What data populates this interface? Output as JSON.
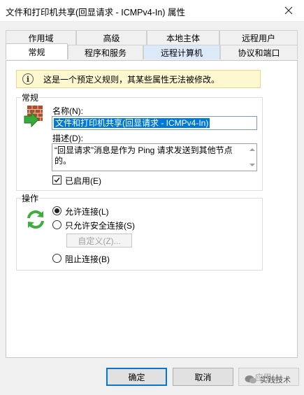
{
  "window": {
    "title": "文件和打印机共享(回显请求 - ICMPv4-In) 属性"
  },
  "tabs": {
    "row1": [
      "作用域",
      "高级",
      "本地主体",
      "远程用户"
    ],
    "row2": [
      "常规",
      "程序和服务",
      "远程计算机",
      "协议和端口"
    ],
    "active": "常规"
  },
  "info_bar": {
    "text": "这是一个预定义规则，其某些属性无法被修改。"
  },
  "general": {
    "group_label": "常规",
    "name_label": "名称(N):",
    "name_value": "文件和打印机共享(回显请求 - ICMPv4-In)",
    "description_label": "描述(D):",
    "description_value": "“回显请求”消息是作为 Ping 请求发送到其他节点的。",
    "enabled_label": "已启用(E)",
    "enabled_checked": true
  },
  "action": {
    "group_label": "操作",
    "options": [
      "允许连接(L)",
      "只允许安全连接(S)",
      "阻止连接(B)"
    ],
    "selected": "允许连接(L)",
    "customize_label": "自定义(Z)..."
  },
  "buttons": {
    "ok": "确定",
    "cancel": "取消",
    "apply": "应用(A)"
  },
  "watermark": {
    "text": "实践技术"
  },
  "colors": {
    "selection": "#0078d7",
    "info_bg": "#fdf8d0",
    "tab_hot": "#dbe9f8"
  }
}
